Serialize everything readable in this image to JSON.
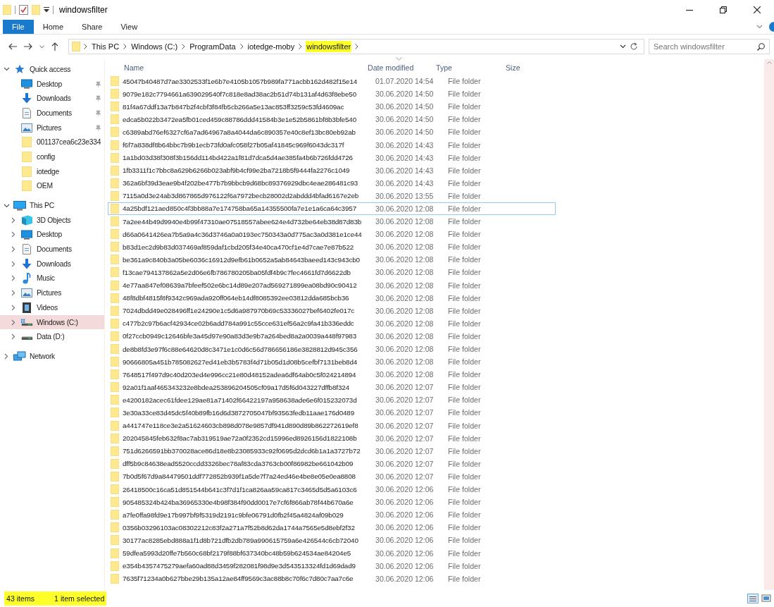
{
  "window": {
    "title": "windowsfilter"
  },
  "ribbon_tabs": [
    {
      "label": "File",
      "kind": "file"
    },
    {
      "label": "Home",
      "kind": "tab"
    },
    {
      "label": "Share",
      "kind": "tab"
    },
    {
      "label": "View",
      "kind": "tab"
    }
  ],
  "address": {
    "crumbs": [
      {
        "label": "This PC",
        "highlighted": false
      },
      {
        "label": "Windows (C:)",
        "highlighted": false
      },
      {
        "label": "ProgramData",
        "highlighted": false
      },
      {
        "label": "iotedge-moby",
        "highlighted": false
      },
      {
        "label": "windowsfilter",
        "highlighted": true
      }
    ]
  },
  "search": {
    "placeholder": "Search windowsfilter"
  },
  "navigation": [
    {
      "label": "Quick access",
      "kind": "star",
      "expanded": true,
      "selected": false,
      "children": [
        {
          "label": "Desktop",
          "kind": "desktop",
          "pinned": true,
          "selected": false
        },
        {
          "label": "Downloads",
          "kind": "download",
          "pinned": true,
          "selected": false
        },
        {
          "label": "Documents",
          "kind": "document",
          "pinned": true,
          "selected": false
        },
        {
          "label": "Pictures",
          "kind": "pictures",
          "pinned": true,
          "selected": false
        },
        {
          "label": "001137cea6c23e334",
          "kind": "folder",
          "pinned": false,
          "selected": false
        },
        {
          "label": "config",
          "kind": "folder",
          "pinned": false,
          "selected": false
        },
        {
          "label": "iotedge",
          "kind": "folder",
          "pinned": false,
          "selected": false
        },
        {
          "label": "OEM",
          "kind": "folder",
          "pinned": false,
          "selected": false
        }
      ]
    },
    {
      "label": "This PC",
      "kind": "pc",
      "expanded": true,
      "selected": false,
      "children": [
        {
          "label": "3D Objects",
          "kind": "cube",
          "expanded": false,
          "selected": false
        },
        {
          "label": "Desktop",
          "kind": "desktop",
          "expanded": false,
          "selected": false
        },
        {
          "label": "Documents",
          "kind": "document",
          "expanded": false,
          "selected": false
        },
        {
          "label": "Downloads",
          "kind": "download",
          "expanded": false,
          "selected": false
        },
        {
          "label": "Music",
          "kind": "music",
          "expanded": false,
          "selected": false
        },
        {
          "label": "Pictures",
          "kind": "pictures",
          "expanded": false,
          "selected": false
        },
        {
          "label": "Videos",
          "kind": "video",
          "expanded": false,
          "selected": false
        },
        {
          "label": "Windows (C:)",
          "kind": "drive-c",
          "expanded": false,
          "selected": true
        },
        {
          "label": "Data (D:)",
          "kind": "drive",
          "expanded": false,
          "selected": false
        }
      ]
    },
    {
      "label": "Network",
      "kind": "network",
      "expanded": false,
      "selected": false
    }
  ],
  "columns": [
    {
      "label": "Name",
      "sorted": false
    },
    {
      "label": "Date modified",
      "sorted": true
    },
    {
      "label": "Type",
      "sorted": false
    },
    {
      "label": "Size",
      "sorted": false
    }
  ],
  "files": [
    {
      "name": "45047b40487d7ae3302533f1e6b7e4105b1057b989fa771acbb162d482f15e14",
      "date": "01.07.2020 14:54",
      "type": "File folder",
      "selected": false
    },
    {
      "name": "9079e182c7794661a639029540f7c818e8ad38ac2b51d74b131af4d63f8ebe50",
      "date": "30.06.2020 14:50",
      "type": "File folder",
      "selected": false
    },
    {
      "name": "81f4a67ddf13a7b847b2f4cbf3f84fb5cb266a5e13ac853ff3259c53fd4609ac",
      "date": "30.06.2020 14:50",
      "type": "File folder",
      "selected": false
    },
    {
      "name": "edca5b022b3472ea5fb01ced459c88786ddd41584b3e1e52b5861bf8b3bfe540",
      "date": "30.06.2020 14:50",
      "type": "File folder",
      "selected": false
    },
    {
      "name": "c6389abd76ef6327cf6a7ad64967a8a4044da6c890357e40c8ef13bc80eb92ab",
      "date": "30.06.2020 14:50",
      "type": "File folder",
      "selected": false
    },
    {
      "name": "f6f7a838df8b64bbc7b9b1ecb73fd0afc058f27b05af41845c969f6043dc317f",
      "date": "30.06.2020 14:43",
      "type": "File folder",
      "selected": false
    },
    {
      "name": "1a1bd03d38f308f3b156dd114bd422a1f81d7dca5d4ae385fa4b6b726fdd4726",
      "date": "30.06.2020 14:43",
      "type": "File folder",
      "selected": false
    },
    {
      "name": "1fb3311f1c7bbc8a629b6266b023abf9b4cf99e2ba7218b5f9444fa2276c1049",
      "date": "30.06.2020 14:43",
      "type": "File folder",
      "selected": false
    },
    {
      "name": "362a6bf39d3eae9b4f202be477b7b9bbcb9d68bc89376929dbc4eae286481c93",
      "date": "30.06.2020 14:43",
      "type": "File folder",
      "selected": false
    },
    {
      "name": "7115a0d3e24ab3d867865d976122f6a7972becb28002d2abddd4bfad6167e2eb",
      "date": "30.06.2020 13:55",
      "type": "File folder",
      "selected": false
    },
    {
      "name": "4a25bdf121aed850c4f3bb88a7e174758ba65a14355500fa7e1e1a6ca64c3957",
      "date": "30.06.2020 12:08",
      "type": "File folder",
      "selected": true
    },
    {
      "name": "7a2ee44b49d9940e4b99f47310ae07518557abee624e4d732be64eb38d87d83b",
      "date": "30.06.2020 12:08",
      "type": "File folder",
      "selected": false
    },
    {
      "name": "d66a0641426ea7b5a9a4c36d3746a0a0193ec750343a0d775ac3a0d381e1ce44",
      "date": "30.06.2020 12:08",
      "type": "File folder",
      "selected": false
    },
    {
      "name": "b83d1ec2d9b83d037469af859daf1cbd205f34e40ca470cf1e4d7cae7e87b522",
      "date": "30.06.2020 12:08",
      "type": "File folder",
      "selected": false
    },
    {
      "name": "be361a9c840b3a05be6036c16912d9efb61b0652a5ab84643baeed143c943cb0",
      "date": "30.06.2020 12:08",
      "type": "File folder",
      "selected": false
    },
    {
      "name": "f13cae794137862a5e2d06e6fb786780205ba05fdf4b9c7fec4661fd7d6622db",
      "date": "30.06.2020 12:08",
      "type": "File folder",
      "selected": false
    },
    {
      "name": "4e77aa847ef08639a7bfeef502e6bc14d89e207ad569271899ea08bd90c90412",
      "date": "30.06.2020 12:08",
      "type": "File folder",
      "selected": false
    },
    {
      "name": "48f8dbf4815f8f9342c969ada920ff064eb14df8085392ee03812dda685bcb36",
      "date": "30.06.2020 12:08",
      "type": "File folder",
      "selected": false
    },
    {
      "name": "7024dbdd49e028496ff1e24290e1c5d6a987970b69c53336027bef6402fe017c",
      "date": "30.06.2020 12:08",
      "type": "File folder",
      "selected": false
    },
    {
      "name": "c477b2c97b6acf42934ce02b6add784a991c55cce631ef56a2c9fa41b336eddc",
      "date": "30.06.2020 12:08",
      "type": "File folder",
      "selected": false
    },
    {
      "name": "0f27ccb0949c12646bfe3a45d97e90a83d3e9b7a264bed8a2a0039a448f97983",
      "date": "30.06.2020 12:08",
      "type": "File folder",
      "selected": false
    },
    {
      "name": "de8b8fd3e97f6c88e64620d8c3471e1c0d6c56d786656186e3828812d945c356",
      "date": "30.06.2020 12:08",
      "type": "File folder",
      "selected": false
    },
    {
      "name": "90666805a451b785082627ed41eb3b5783f4d71b05d1d08b5cefbf7131beb8d4",
      "date": "30.06.2020 12:08",
      "type": "File folder",
      "selected": false
    },
    {
      "name": "7648517f497d9c40d203ed4e996cc21e80d48152adea6df64ab0c5f024214894",
      "date": "30.06.2020 12:08",
      "type": "File folder",
      "selected": false
    },
    {
      "name": "92a01f1aaf465343232e8bdea253896204505cf09a17d5f6d043227dffb8f324",
      "date": "30.06.2020 12:07",
      "type": "File folder",
      "selected": false
    },
    {
      "name": "e4200182acec61fdee129ae81a71402f66422197a958638ade6e6f015232073d",
      "date": "30.06.2020 12:07",
      "type": "File folder",
      "selected": false
    },
    {
      "name": "3e30a33ce83d45dc5f40b89fb16d6d3872705047bf93563fedb11aae176d0489",
      "date": "30.06.2020 12:07",
      "type": "File folder",
      "selected": false
    },
    {
      "name": "a441747e118ce3e2a51624603cb898d078e9857df941d890d89b862272619ef8",
      "date": "30.06.2020 12:07",
      "type": "File folder",
      "selected": false
    },
    {
      "name": "202045845feb632f8ac7ab319519ae72a0f2352cd15996ed8926156d1822108b",
      "date": "30.06.2020 12:07",
      "type": "File folder",
      "selected": false
    },
    {
      "name": "751d6266591bb370028ace86d18e8b23085933c92f0695d2dcd6b1a1a3727b72",
      "date": "30.06.2020 12:07",
      "type": "File folder",
      "selected": false
    },
    {
      "name": "dff5b9c84638ead5520ccdd3326bec78af83cda3763cb00f86982be661042b09",
      "date": "30.06.2020 12:07",
      "type": "File folder",
      "selected": false
    },
    {
      "name": "7b0d5f67d9a84479501ddf772852b939f1a5de7f7a24ed46e4be8e05e0ea8808",
      "date": "30.06.2020 12:07",
      "type": "File folder",
      "selected": false
    },
    {
      "name": "26418500c16ca51d851544b641c3f7d1f1ca826aa59ca817c3465d5d5a6103c6",
      "date": "30.06.2020 12:06",
      "type": "File folder",
      "selected": false
    },
    {
      "name": "905485324b424ba36965330e4b98f384f90dd0017e7cf6f866ab78f44b670a6e",
      "date": "30.06.2020 12:06",
      "type": "File folder",
      "selected": false
    },
    {
      "name": "a7fe0ffa98fd9e17b997bf9f5319d2191c9bfe06791d0fb2f45a4824af09b029",
      "date": "30.06.2020 12:06",
      "type": "File folder",
      "selected": false
    },
    {
      "name": "0356b03296103ac08302212c83f2a271a7f52b8d62da1744a7565e5d8ebf2f32",
      "date": "30.06.2020 12:06",
      "type": "File folder",
      "selected": false
    },
    {
      "name": "30177ac8285ebd888a1f1d8b721dfb2db789a990615759a6e426544c6cb72040",
      "date": "30.06.2020 12:06",
      "type": "File folder",
      "selected": false
    },
    {
      "name": "59dfea5993d20ffe7b560c68bf2179f88bf637340bc48b59b624534ae84204e5",
      "date": "30.06.2020 12:06",
      "type": "File folder",
      "selected": false
    },
    {
      "name": "e354b4357475279aefa60ad88d3459f282081f98d9e3d543513324fd1d69dad9",
      "date": "30.06.2020 12:06",
      "type": "File folder",
      "selected": false
    },
    {
      "name": "7635f71234a0b627bbe29b135a12ae84ff9569c3ac88b8c70f6c7d80c7aa7c6e",
      "date": "30.06.2020 12:06",
      "type": "File folder",
      "selected": false
    }
  ],
  "status": [
    {
      "text": "43 items",
      "highlighted": true
    },
    {
      "text": "1 item selected",
      "highlighted": true
    }
  ]
}
